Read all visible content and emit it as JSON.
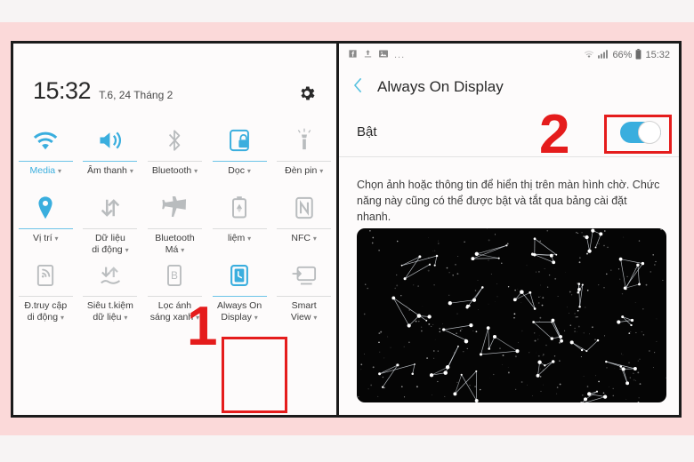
{
  "left_panel": {
    "status": {
      "time": "15:32",
      "date": "T.6, 24 Tháng 2"
    },
    "gear_icon": "gear-icon",
    "tiles": [
      {
        "label": "Media",
        "icon": "wifi-icon",
        "active": true,
        "caret": true
      },
      {
        "label": "Âm thanh",
        "icon": "volume-icon",
        "active": true,
        "caret": true
      },
      {
        "label": "Bluetooth",
        "icon": "bluetooth-icon",
        "active": false,
        "caret": true
      },
      {
        "label": "Dọc",
        "icon": "screen-lock-rotation-icon",
        "active": true,
        "caret": true
      },
      {
        "label": "Đèn pin",
        "icon": "flashlight-icon",
        "active": false,
        "caret": true
      },
      {
        "label": "Vị trí",
        "icon": "location-pin-icon",
        "active": true,
        "caret": true
      },
      {
        "label": "Dữ liệu\ndi động",
        "icon": "mobile-data-icon",
        "active": false,
        "caret": true
      },
      {
        "label": "Bluetooth\nMá",
        "icon": "airplane-icon",
        "active": false,
        "caret": true
      },
      {
        "label": "liệm",
        "icon": "battery-saver-icon",
        "active": false,
        "caret": true
      },
      {
        "label": "NFC",
        "icon": "nfc-icon",
        "active": false,
        "caret": true
      },
      {
        "label": "Đ.truy cập\ndi động",
        "icon": "mobile-hotspot-icon",
        "active": false,
        "caret": true
      },
      {
        "label": "Siêu t.kiệm\ndữ liệu",
        "icon": "data-saver-icon",
        "active": false,
        "caret": true
      },
      {
        "label": "Lọc ánh\nsáng xanh",
        "icon": "blue-light-filter-icon",
        "active": false,
        "caret": true
      },
      {
        "label": "Always On\nDisplay",
        "icon": "always-on-display-icon",
        "active": true,
        "caret": true
      },
      {
        "label": "Smart\nView",
        "icon": "smart-view-icon",
        "active": false,
        "caret": true
      }
    ],
    "annotation_number": "1"
  },
  "right_panel": {
    "statusbar": {
      "left_icons": [
        "facebook-icon",
        "upload-icon",
        "image-icon"
      ],
      "overflow": "...",
      "wifi_icon": "wifi-icon",
      "signal_icon": "signal-bars-icon",
      "battery_percent": "66%",
      "battery_icon": "battery-icon",
      "time": "15:32"
    },
    "appbar": {
      "back_icon": "back-chevron-icon",
      "title": "Always On Display"
    },
    "toggle": {
      "label": "Bật",
      "state": "on"
    },
    "annotation_number": "2",
    "description": "Chọn ảnh hoặc thông tin để hiển thị trên màn hình chờ. Chức năng này cũng có thể được bật và tắt qua bảng cài đặt nhanh.",
    "preview": {
      "name": "constellation-wallpaper-preview",
      "background": "#050505"
    }
  },
  "colors": {
    "accent": "#3aaede",
    "annotation_red": "#e51c1c",
    "backdrop_pink": "#fbd9d9",
    "panel_bg": "#fdfbfb"
  }
}
